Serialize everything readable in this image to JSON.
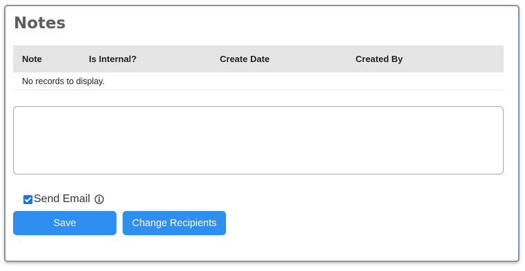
{
  "panel": {
    "title": "Notes"
  },
  "table": {
    "columns": [
      "Note",
      "Is Internal?",
      "Create Date",
      "Created By"
    ],
    "empty_message": "No records to display."
  },
  "note_input": {
    "value": "",
    "placeholder": ""
  },
  "send_email": {
    "label": "Send Email",
    "checked": true,
    "info_icon": "info-icon"
  },
  "actions": {
    "save_label": "Save",
    "change_recipients_label": "Change Recipients"
  },
  "colors": {
    "accent": "#2f8ff0",
    "header_bg": "#e5e5e5",
    "title": "#5d5d5d"
  }
}
